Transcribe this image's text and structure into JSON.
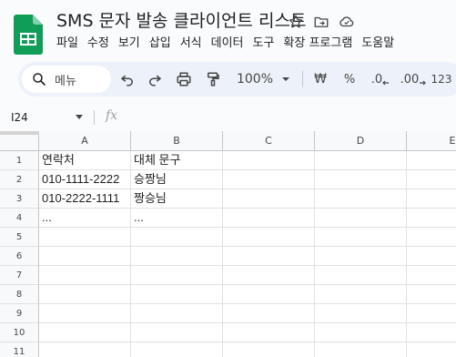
{
  "app": {
    "title": "SMS 문자 발송 클라이언트 리스트",
    "brand_color": "#0f9d58"
  },
  "menu": [
    "파일",
    "수정",
    "보기",
    "삽입",
    "서식",
    "데이터",
    "도구",
    "확장 프로그램",
    "도움말"
  ],
  "toolbar": {
    "search_label": "메뉴",
    "zoom": "100%",
    "currency": "₩",
    "percent": "%",
    "dec_decrease": ".0",
    "dec_increase": ".00",
    "number_format": "123"
  },
  "formula_bar": {
    "name_box": "I24",
    "fx": "fx",
    "value": ""
  },
  "sheet": {
    "columns": [
      "A",
      "B",
      "C",
      "D",
      "E"
    ],
    "rows": [
      "1",
      "2",
      "3",
      "4",
      "5",
      "6",
      "7",
      "8",
      "9",
      "10",
      "11"
    ],
    "cells": [
      [
        "연락처",
        "대체 문구",
        "",
        "",
        ""
      ],
      [
        "010-1111-2222",
        "승짱님",
        "",
        "",
        ""
      ],
      [
        "010-2222-1111",
        "짱승님",
        "",
        "",
        ""
      ],
      [
        "...",
        "...",
        "",
        "",
        ""
      ],
      [
        "",
        "",
        "",
        "",
        ""
      ],
      [
        "",
        "",
        "",
        "",
        ""
      ],
      [
        "",
        "",
        "",
        "",
        ""
      ],
      [
        "",
        "",
        "",
        "",
        ""
      ],
      [
        "",
        "",
        "",
        "",
        ""
      ],
      [
        "",
        "",
        "",
        "",
        ""
      ],
      [
        "",
        "",
        "",
        "",
        ""
      ]
    ]
  }
}
